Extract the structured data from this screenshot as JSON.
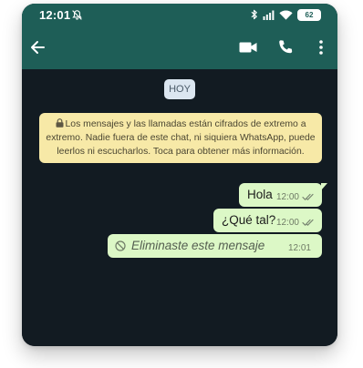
{
  "status_bar": {
    "time": "12:01",
    "battery": "62"
  },
  "app_bar": {
    "back_icon": "arrow-back-icon",
    "video_icon": "videocam-icon",
    "call_icon": "phone-icon",
    "menu_icon": "more-vert-icon"
  },
  "chat": {
    "date_chip": "HOY",
    "encryption_notice": "Los mensajes y las llamadas están cifrados de extremo a extremo. Nadie fuera de este chat, ni siquiera WhatsApp, puede leerlos ni escucharlos. Toca para obtener más información.",
    "messages": [
      {
        "text": "Hola",
        "time": "12:00",
        "status": "read-double-check"
      },
      {
        "text": "¿Qué tal?",
        "time": "12:00",
        "status": "read-double-check"
      },
      {
        "text": "Eliminaste este mensaje",
        "time": "12:01",
        "deleted": true
      }
    ]
  },
  "colors": {
    "header": "#1e5e57",
    "chat_background": "#121b22",
    "outgoing_bubble": "#dcf8c6",
    "notice_background": "#f7e9a7",
    "date_chip_background": "#dbe6f0"
  }
}
